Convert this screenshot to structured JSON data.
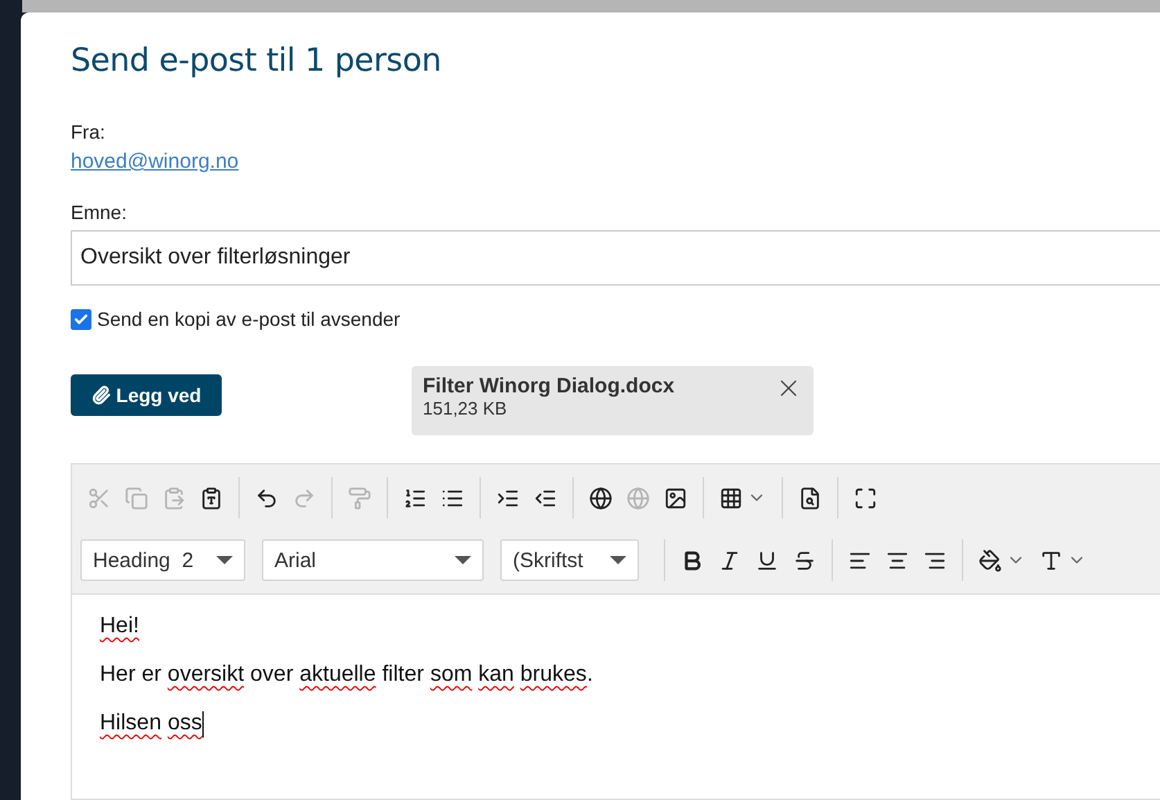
{
  "dialog": {
    "title": "Send e-post til 1 person"
  },
  "from": {
    "label": "Fra:",
    "address": "hoved@winorg.no"
  },
  "subject": {
    "label": "Emne:",
    "value": "Oversikt over filterløsninger"
  },
  "copy_to_sender": {
    "label": "Send en kopi av e-post til avsender",
    "checked": true
  },
  "attach_button": {
    "label": "Legg ved"
  },
  "attachments": [
    {
      "name": "Filter Winorg Dialog.docx",
      "size": "151,23 KB"
    }
  ],
  "toolbar_rows": [
    [
      {
        "kind": "cut",
        "disabled": true
      },
      {
        "kind": "copy",
        "disabled": true
      },
      {
        "kind": "paste",
        "disabled": true
      },
      {
        "kind": "paste-word",
        "disabled": false
      },
      {
        "kind": "separator"
      },
      {
        "kind": "undo",
        "disabled": false
      },
      {
        "kind": "redo",
        "disabled": true
      },
      {
        "kind": "separator"
      },
      {
        "kind": "clear-format",
        "disabled": true
      },
      {
        "kind": "separator"
      },
      {
        "kind": "numbered-list",
        "disabled": false
      },
      {
        "kind": "bullet-list",
        "disabled": false
      },
      {
        "kind": "separator"
      },
      {
        "kind": "indent",
        "disabled": false
      },
      {
        "kind": "outdent",
        "disabled": false
      },
      {
        "kind": "separator"
      },
      {
        "kind": "link",
        "disabled": false
      },
      {
        "kind": "unlink",
        "disabled": true
      },
      {
        "kind": "image",
        "disabled": false
      },
      {
        "kind": "separator"
      },
      {
        "kind": "table",
        "disabled": false
      },
      {
        "kind": "separator"
      },
      {
        "kind": "preview",
        "disabled": false
      },
      {
        "kind": "separator"
      },
      {
        "kind": "fullscreen",
        "disabled": false
      }
    ],
    [
      {
        "kind": "select",
        "value": "Heading  2"
      },
      {
        "kind": "select",
        "value": "Arial"
      },
      {
        "kind": "select",
        "value": "(Skriftst"
      },
      {
        "kind": "separator"
      },
      {
        "kind": "bold",
        "disabled": false
      },
      {
        "kind": "italic",
        "disabled": false
      },
      {
        "kind": "underline",
        "disabled": false
      },
      {
        "kind": "strike",
        "disabled": false
      },
      {
        "kind": "separator"
      },
      {
        "kind": "align-left",
        "disabled": false
      },
      {
        "kind": "align-center",
        "disabled": false
      },
      {
        "kind": "align-right",
        "disabled": false
      },
      {
        "kind": "separator"
      },
      {
        "kind": "fill-color",
        "disabled": false
      },
      {
        "kind": "text-color",
        "disabled": false
      }
    ]
  ],
  "body": [
    [
      {
        "text": "Hei!",
        "spell_error": true
      }
    ],
    [
      {
        "text": "Her er",
        "spell_error": false
      },
      {
        "text": "oversikt",
        "spell_error": true
      },
      {
        "text": "over",
        "spell_error": false
      },
      {
        "text": "aktuelle",
        "spell_error": true
      },
      {
        "text": "filter",
        "spell_error": false
      },
      {
        "text": "som",
        "spell_error": true
      },
      {
        "text": "kan",
        "spell_error": true
      },
      {
        "text": "brukes",
        "spell_error": true
      },
      {
        "text": ".",
        "spell_error": false
      }
    ],
    [
      {
        "text": "Hilsen",
        "spell_error": true
      },
      {
        "text": "oss",
        "spell_error": true
      }
    ]
  ]
}
